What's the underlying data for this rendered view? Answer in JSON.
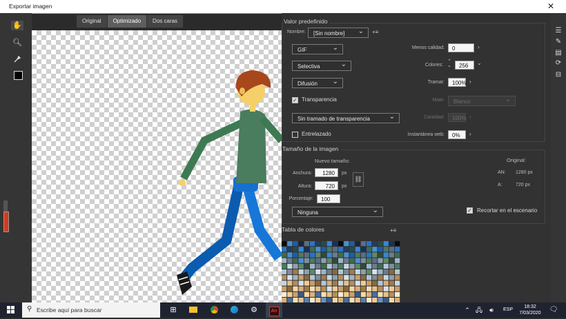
{
  "window": {
    "title": "Exportar imagen"
  },
  "tabs": [
    {
      "label": "Original",
      "active": false
    },
    {
      "label": "Optimizado",
      "active": true
    },
    {
      "label": "Dos caras",
      "active": false
    }
  ],
  "tools": [
    "hand-icon",
    "zoom-icon",
    "eyedropper-icon"
  ],
  "preset": {
    "section_title": "Valor predefinido",
    "name_label": "Nombre:",
    "name_value": "[Sin nombre]",
    "format": "GIF",
    "reduction": "Selectiva",
    "dither": "Difusión",
    "transparency_label": "Transparencia",
    "transparency_checked": true,
    "transparency_dither": "Sin tramado de transparencia",
    "interlaced_label": "Entrelazado",
    "interlaced_checked": false,
    "lossy_label": "Menos calidad:",
    "lossy_value": "0",
    "colors_label": "Colores:",
    "colors_value": "256",
    "dither_amount_label": "Tramar:",
    "dither_amount_value": "100%",
    "matte_label": "Mate:",
    "matte_value": "Blanco",
    "amount_label": "Cantidad:",
    "amount_value": "100%",
    "websnap_label": "Instantánea web:",
    "websnap_value": "0%"
  },
  "image_size": {
    "section_title": "Tamaño de la imagen",
    "new_size_label": "Nuevo tamaño:",
    "width_label": "Anchura:",
    "width_value": "1280",
    "height_label": "Altura:",
    "height_value": "720",
    "unit": "px",
    "percent_label": "Porcentaje:",
    "percent_value": "100",
    "quality": "Ninguna",
    "original_label": "Original:",
    "orig_w_label": "AN:",
    "orig_w_value": "1280 px",
    "orig_h_label": "A:",
    "orig_h_value": "720 px",
    "clip_label": "Recortar en el escenario",
    "clip_checked": true
  },
  "color_table": {
    "section_title": "Tabla de colores",
    "palette": [
      "#0a0a0a",
      "#1a2538",
      "#223d5e",
      "#12335c",
      "#1a5fa8",
      "#2a73c8",
      "#3a85d8",
      "#4a8fd0",
      "#5b6e82",
      "#2d4a3c",
      "#3f6b52",
      "#4c7a5e",
      "#5c8a6a",
      "#6a7d8c",
      "#7d8e9c",
      "#8fa0b0",
      "#a0b4c8",
      "#b4c6d6",
      "#c8d6e2",
      "#d8e2ec",
      "#8a6a3c",
      "#a07c4a",
      "#b48e5a",
      "#c8a06a",
      "#d8b07a",
      "#e6c08a",
      "#f0cc96",
      "#f6d8a8",
      "#f2e0b8",
      "#f8ecd0",
      "#3a5a8a",
      "#4a6e9c",
      "#5a80ae",
      "#6a92c0",
      "#7aa4d0",
      "#8ab6dc",
      "#9cc6e6",
      "#aed4ee",
      "#c0e0f4",
      "#7a8a3a",
      "#8c9c4a",
      "#9eae5a",
      "#b0c06a",
      "#c2d07a",
      "#d4de8a"
    ]
  },
  "rightbar": [
    "sliders-icon",
    "brush-icon",
    "libraries-icon",
    "transform-icon",
    "align-icon"
  ],
  "taskbar": {
    "search_placeholder": "Escribe aquí para buscar",
    "lang": "ESP",
    "time": "18:32",
    "date": "7/03/2020",
    "animate_label": "An"
  }
}
